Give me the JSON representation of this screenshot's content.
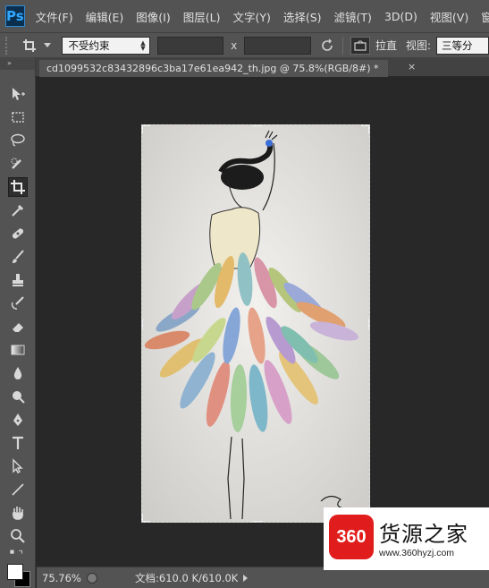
{
  "app": {
    "logo_text": "Ps",
    "accent_color": "#31a8ff"
  },
  "menu": {
    "items": [
      "文件(F)",
      "编辑(E)",
      "图像(I)",
      "图层(L)",
      "文字(Y)",
      "选择(S)",
      "滤镜(T)",
      "3D(D)",
      "视图(V)",
      "窗"
    ]
  },
  "options_bar": {
    "tool_icon": "crop-icon",
    "ratio_value": "不受约束",
    "width_value": "",
    "height_value": "",
    "x_separator": "x",
    "straighten_label": "拉直",
    "view_label": "视图:",
    "view_value": "三等分"
  },
  "tab": {
    "title": "cd1099532c83432896c3ba17e61ea942_th.jpg @ 75.8%(RGB/8#) *",
    "close_glyph": "×"
  },
  "tools": [
    "move-icon",
    "marquee-icon",
    "lasso-icon",
    "quick-select-icon",
    "crop-icon",
    "eyedropper-icon",
    "healing-brush-icon",
    "brush-icon",
    "clone-stamp-icon",
    "history-brush-icon",
    "eraser-icon",
    "gradient-icon",
    "blur-icon",
    "dodge-icon",
    "pen-icon",
    "type-icon",
    "path-select-icon",
    "line-icon",
    "hand-icon",
    "zoom-icon"
  ],
  "status": {
    "zoom": "75.76%",
    "doc_size": "文档:610.0 K/610.0K"
  },
  "watermark": {
    "badge": "360",
    "title": "货源之家",
    "url": "www.360hyzj.com"
  },
  "colors": {
    "ui_gray": "#535353",
    "canvas_bg": "#282828",
    "foreground": "#ffffff",
    "background": "#000000"
  }
}
